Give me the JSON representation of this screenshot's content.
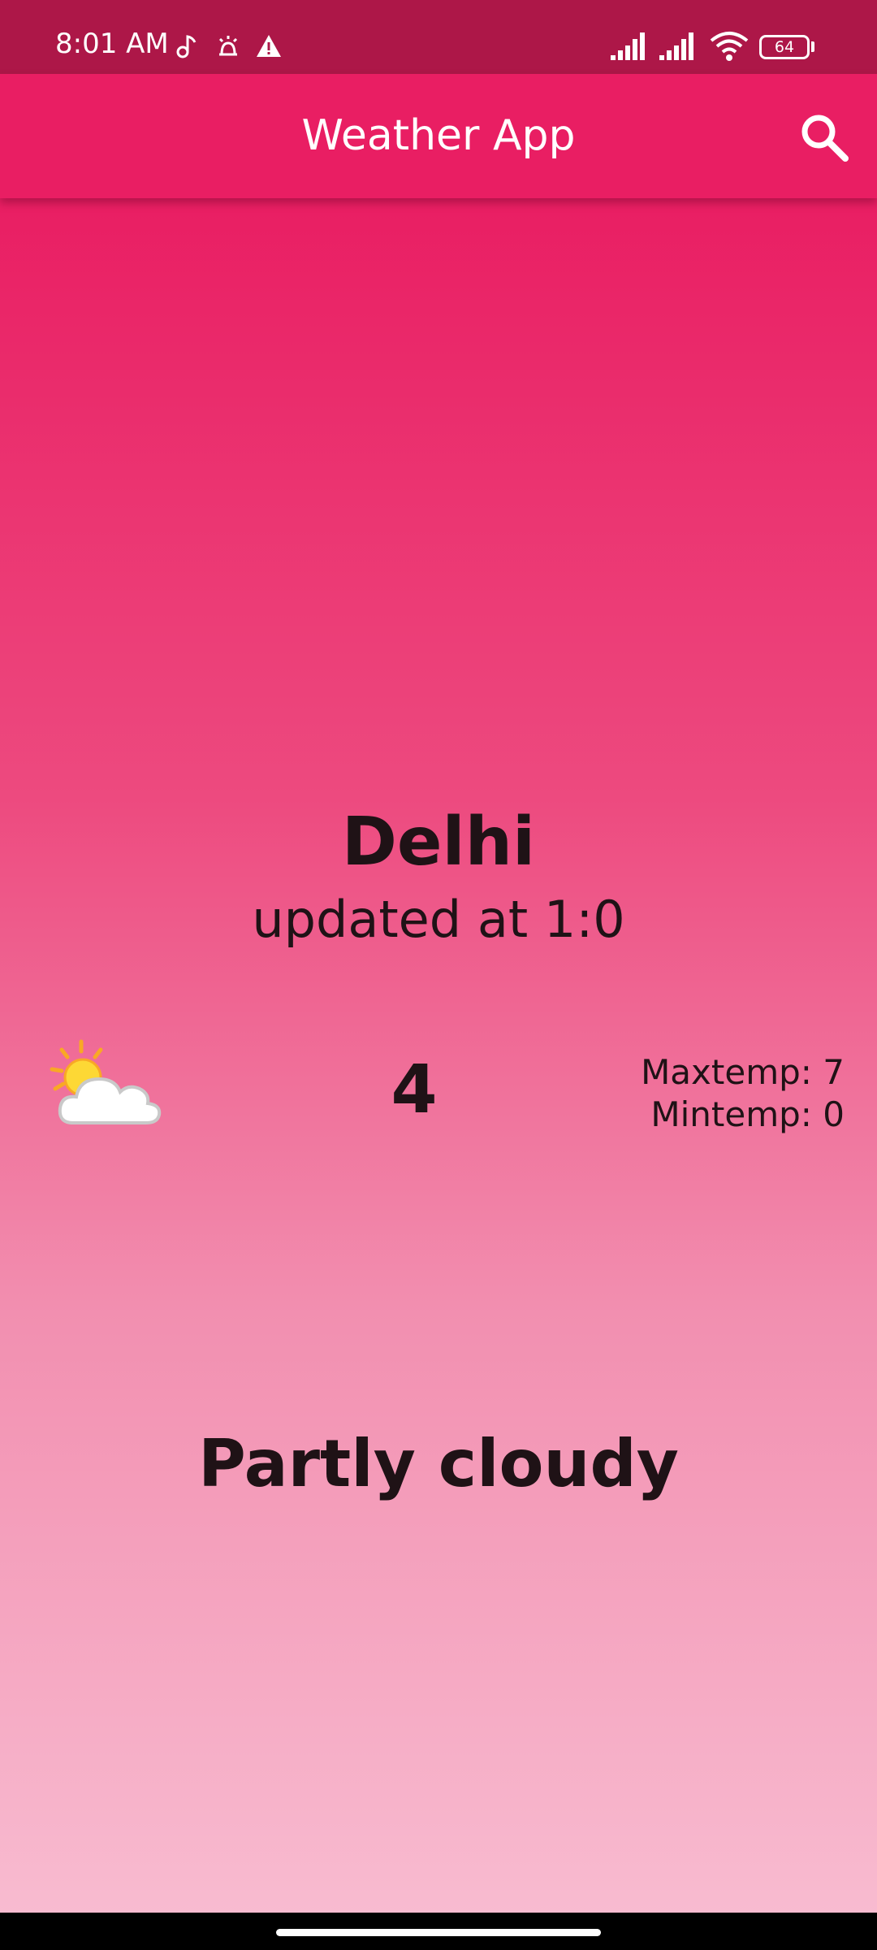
{
  "status_bar": {
    "time": "8:01 AM",
    "battery_level": "64",
    "left_icons": [
      "music-note-icon",
      "alarm-icon",
      "warning-icon"
    ],
    "right_icons": [
      "signal-icon",
      "signal-icon",
      "wifi-icon",
      "battery-icon"
    ]
  },
  "app_bar": {
    "title": "Weather App",
    "search_icon": "search-icon"
  },
  "weather": {
    "city": "Delhi",
    "updated": "updated at 1:0",
    "icon": "partly-cloudy-icon",
    "temperature": "4",
    "max_temp": "Maxtemp: 7",
    "min_temp": "Mintemp: 0",
    "condition": "Partly cloudy"
  },
  "colors": {
    "status_bar": "#ad1748",
    "app_bar": "#e91e63",
    "gradient_top": "#e91e63",
    "gradient_bottom": "#f8bbd0",
    "text_dark": "#1f1216"
  }
}
